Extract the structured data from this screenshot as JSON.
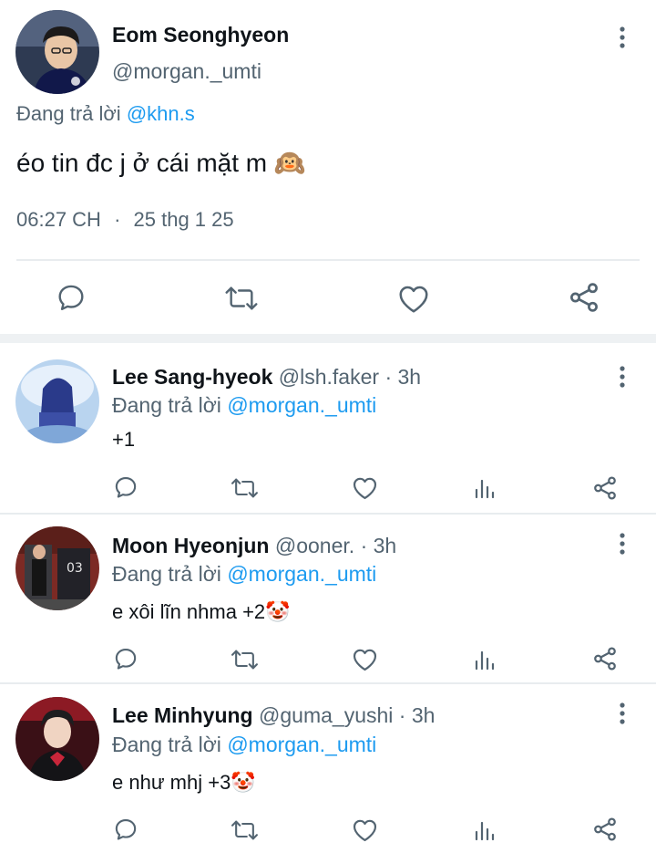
{
  "main_tweet": {
    "display_name": "Eom Seonghyeon",
    "handle": "@morgan._umti",
    "reply_prefix": "Đang trả lời",
    "reply_to": "@khn.s",
    "text": "éo tin đc j ở cái mặt m",
    "emoji": "🙉",
    "time": "06:27 CH",
    "separator": "·",
    "date": "25 thg 1 25"
  },
  "replies": [
    {
      "display_name": "Lee Sang-hyeok",
      "handle": "@lsh.faker",
      "dot": "·",
      "age": "3h",
      "reply_prefix": "Đang trả lời",
      "reply_to": "@morgan._umti",
      "text": "+1",
      "emoji": ""
    },
    {
      "display_name": "Moon Hyeonjun",
      "handle": "@ooner.",
      "dot": "·",
      "age": "3h",
      "reply_prefix": "Đang trả lời",
      "reply_to": "@morgan._umti",
      "text": "e xôi lĩn nhma +2",
      "emoji": "🤡"
    },
    {
      "display_name": "Lee Minhyung",
      "handle": "@guma_yushi",
      "dot": "·",
      "age": "3h",
      "reply_prefix": "Đang trả lời",
      "reply_to": "@morgan._umti",
      "text": "e như mhj +3",
      "emoji": "🤡"
    }
  ],
  "colors": {
    "text": "#0f1419",
    "muted": "#536471",
    "link": "#1d9bf0",
    "divider": "#e8ecef"
  },
  "icons": [
    "more-vertical-icon",
    "reply-icon",
    "retweet-icon",
    "like-icon",
    "views-icon",
    "share-icon"
  ]
}
